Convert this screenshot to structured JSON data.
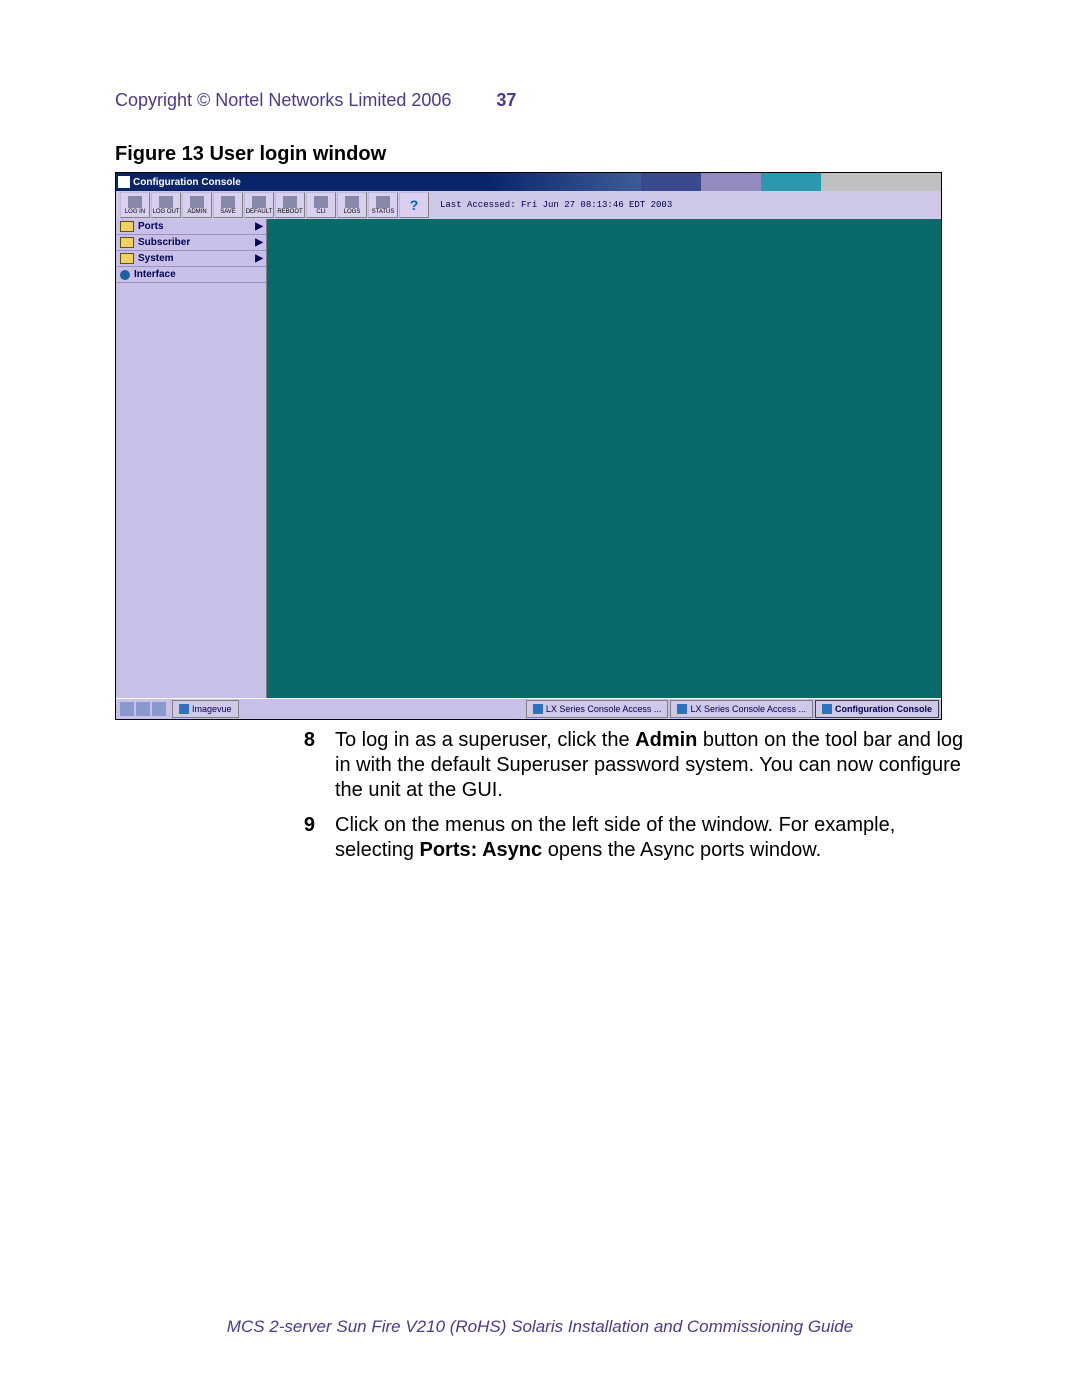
{
  "header": {
    "copyright": "Copyright © Nortel Networks Limited 2006",
    "page_number": "37"
  },
  "figure": {
    "caption": "Figure 13  User login window"
  },
  "screenshot": {
    "title": "Configuration Console",
    "toolbar_buttons": [
      {
        "label": "LOG IN"
      },
      {
        "label": "LOG OUT"
      },
      {
        "label": "ADMIN"
      },
      {
        "label": "SAVE"
      },
      {
        "label": "DEFAULT"
      },
      {
        "label": "REBOOT"
      },
      {
        "label": "CLI"
      },
      {
        "label": "LOGS"
      },
      {
        "label": "STATUS"
      },
      {
        "label": "?"
      }
    ],
    "last_accessed": "Last Accessed: Fri Jun 27 08:13:46 EDT 2003",
    "tree": [
      {
        "label": "Ports",
        "type": "folder",
        "has_children": true
      },
      {
        "label": "Subscriber",
        "type": "folder",
        "has_children": true
      },
      {
        "label": "System",
        "type": "folder",
        "has_children": true
      },
      {
        "label": "Interface",
        "type": "globe",
        "has_children": false
      }
    ],
    "taskbar": {
      "imagevue": "Imagevue",
      "items": [
        "LX Series Console Access ...",
        "LX Series Console Access ...",
        "Configuration Console"
      ]
    }
  },
  "steps": [
    {
      "num": "8",
      "text_before": "To log in as a superuser, click the ",
      "bold1": "Admin",
      "text_after": " button on the tool bar and log in with the default Superuser password system. You can now configure the unit at the GUI."
    },
    {
      "num": "9",
      "text_before": "Click on the menus on the left side of the window. For example, selecting ",
      "bold1": "Ports: Async",
      "text_after": " opens the Async ports window."
    }
  ],
  "footer": "MCS 2-server Sun Fire V210 (RoHS) Solaris Installation and Commissioning Guide"
}
